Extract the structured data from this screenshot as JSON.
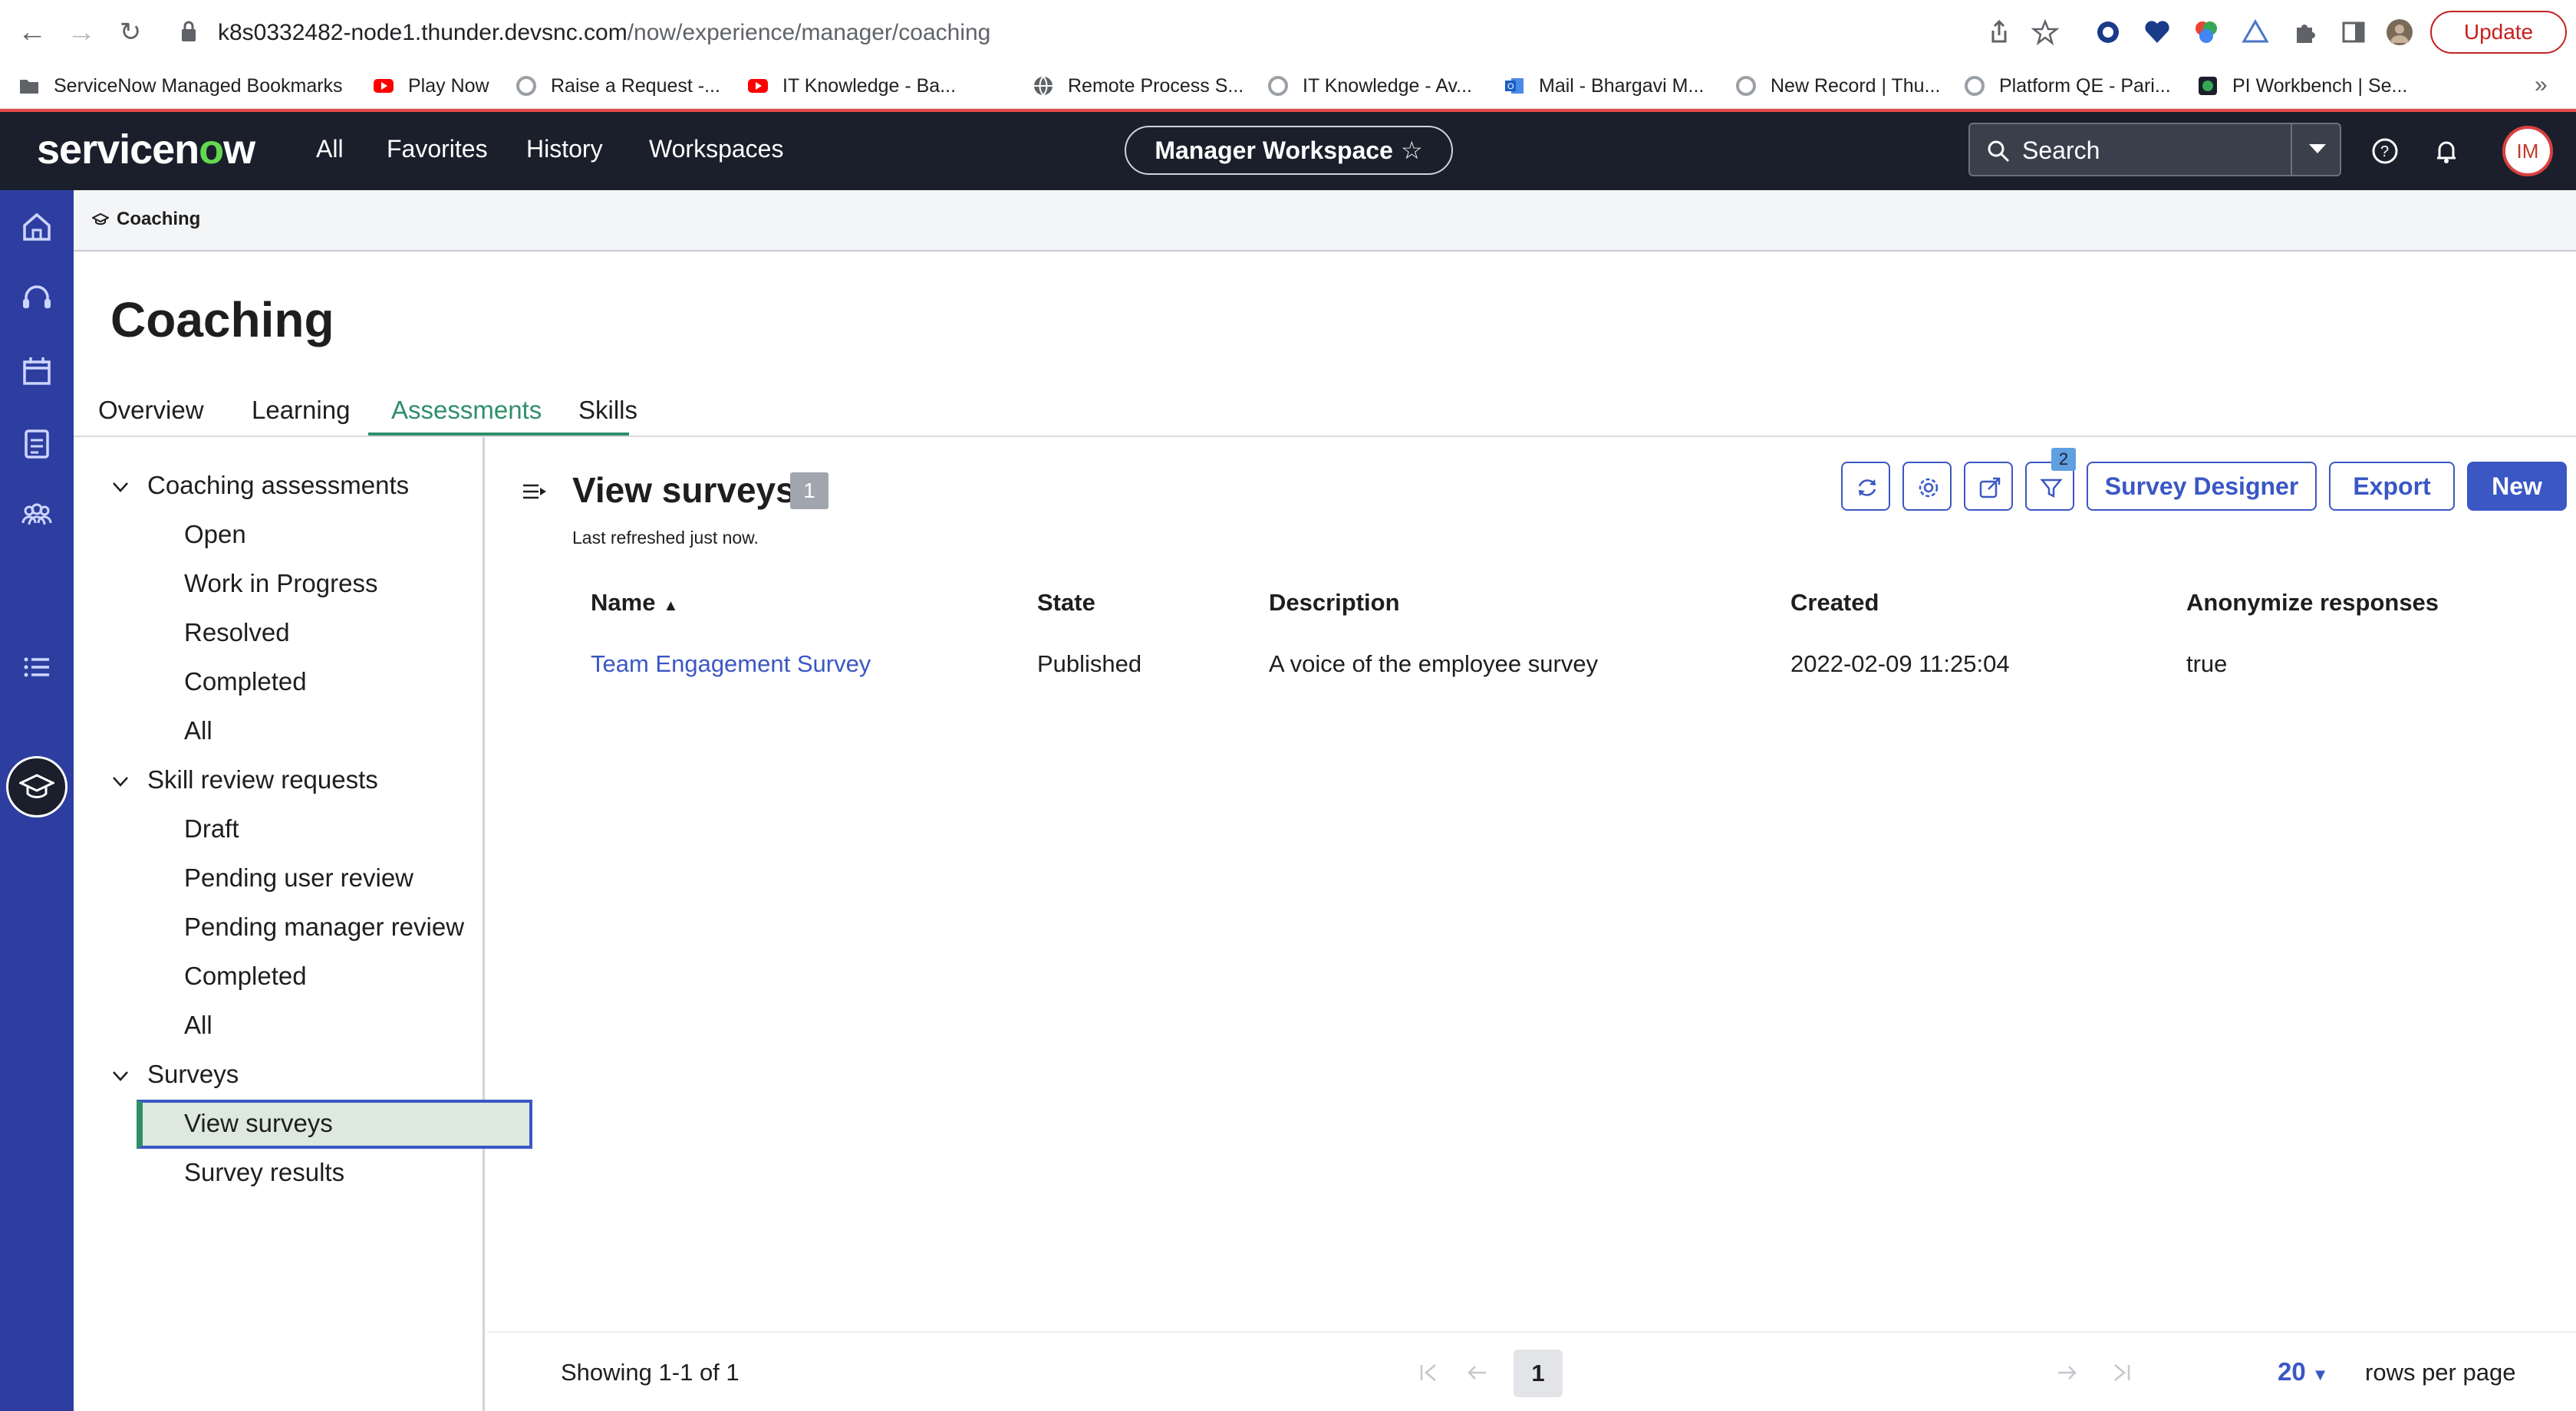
{
  "browser": {
    "url_host": "k8s0332482-node1.thunder.devsnc.com",
    "url_path": "/now/experience/manager/coaching",
    "update_label": "Update",
    "bookmarks": [
      {
        "label": "ServiceNow Managed Bookmarks",
        "icon": "folder-icon",
        "color": "#5f6368"
      },
      {
        "label": "Play Now",
        "icon": "youtube-icon",
        "color": "#ff0000"
      },
      {
        "label": "Raise a Request -...",
        "icon": "servicenow-icon",
        "color": "#9aa0a6"
      },
      {
        "label": "IT Knowledge - Ba...",
        "icon": "youtube-icon",
        "color": "#ff0000"
      },
      {
        "label": "Remote Process S...",
        "icon": "globe-icon",
        "color": "#5f6368"
      },
      {
        "label": "IT Knowledge - Av...",
        "icon": "servicenow-icon",
        "color": "#9aa0a6"
      },
      {
        "label": "Mail - Bhargavi M...",
        "icon": "outlook-icon",
        "color": "#1a73e8"
      },
      {
        "label": "New Record | Thu...",
        "icon": "servicenow-icon",
        "color": "#9aa0a6"
      },
      {
        "label": "Platform QE - Pari...",
        "icon": "servicenow-icon",
        "color": "#9aa0a6"
      },
      {
        "label": "PI Workbench | Se...",
        "icon": "pi-icon",
        "color": "#34a853"
      }
    ]
  },
  "header": {
    "logo_text_a": "servicen",
    "logo_text_o": "o",
    "logo_text_b": "w",
    "nav": [
      "All",
      "Favorites",
      "History",
      "Workspaces"
    ],
    "workspace": "Manager Workspace",
    "search_placeholder": "Search",
    "avatar_initials": "IM"
  },
  "breadcrumb": "Coaching",
  "page_title": "Coaching",
  "tabs": [
    "Overview",
    "Learning",
    "Assessments",
    "Skills"
  ],
  "active_tab": "Assessments",
  "tree": {
    "groups": [
      {
        "label": "Coaching assessments",
        "items": [
          "Open",
          "Work in Progress",
          "Resolved",
          "Completed",
          "All"
        ]
      },
      {
        "label": "Skill review requests",
        "items": [
          "Draft",
          "Pending user review",
          "Pending manager review",
          "Completed",
          "All"
        ]
      },
      {
        "label": "Surveys",
        "items": [
          "View surveys",
          "Survey results"
        ]
      }
    ],
    "selected": "View surveys"
  },
  "list": {
    "title": "View surveys",
    "count": "1",
    "refreshed": "Last refreshed just now.",
    "filter_count": "2",
    "buttons": {
      "survey_designer": "Survey Designer",
      "export": "Export",
      "new": "New"
    },
    "columns": [
      "Name",
      "State",
      "Description",
      "Created",
      "Anonymize responses"
    ],
    "sort_column": "Name",
    "sort_dir": "ascending",
    "rows": [
      {
        "name": "Team Engagement Survey",
        "state": "Published",
        "description": "A voice of the employee survey",
        "created": "2022-02-09 11:25:04",
        "anonymize": "true"
      }
    ]
  },
  "pagination": {
    "showing": "Showing 1-1 of 1",
    "current_page": "1",
    "rows_per_page": "20",
    "rows_per_page_label": "rows per page"
  },
  "colors": {
    "header_bg": "#1b1f2b",
    "rail_bg": "#2e3ea0",
    "accent": "#3a57c4",
    "active_tab": "#2f8f6a",
    "logo_o": "#62d84e"
  }
}
